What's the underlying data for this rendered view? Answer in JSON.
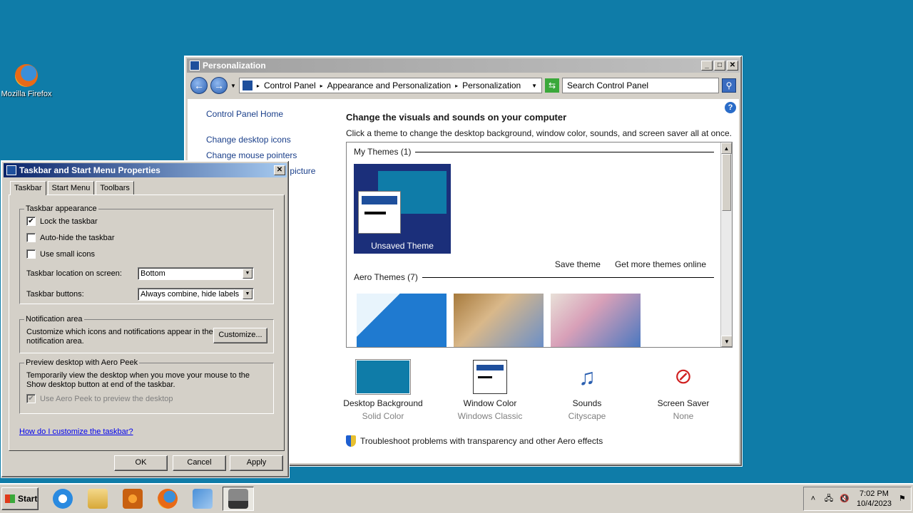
{
  "desktop": {
    "icons": [
      {
        "label": "Mozilla Firefox",
        "icon": "firefox-icon"
      }
    ]
  },
  "personalization": {
    "title": "Personalization",
    "breadcrumb": [
      "Control Panel",
      "Appearance and Personalization",
      "Personalization"
    ],
    "search_placeholder": "Search Control Panel",
    "left_nav": {
      "home": "Control Panel Home",
      "links": [
        "Change desktop icons",
        "Change mouse pointers",
        "Change your account picture"
      ]
    },
    "heading": "Change the visuals and sounds on your computer",
    "subheading": "Click a theme to change the desktop background, window color, sounds, and screen saver all at once.",
    "my_themes_header": "My Themes (1)",
    "my_theme_name": "Unsaved Theme",
    "save_theme": "Save theme",
    "get_more_themes": "Get more themes online",
    "aero_themes_header": "Aero Themes (7)",
    "bottom": [
      {
        "label": "Desktop Background",
        "sub": "Solid Color",
        "icon": "desktop-background-icon"
      },
      {
        "label": "Window Color",
        "sub": "Windows Classic",
        "icon": "window-color-icon"
      },
      {
        "label": "Sounds",
        "sub": "Cityscape",
        "icon": "sounds-icon"
      },
      {
        "label": "Screen Saver",
        "sub": "None",
        "icon": "screen-saver-icon"
      }
    ],
    "troubleshoot": "Troubleshoot problems with transparency and other Aero effects"
  },
  "taskbar_props": {
    "title": "Taskbar and Start Menu Properties",
    "tabs": [
      "Taskbar",
      "Start Menu",
      "Toolbars"
    ],
    "appearance_legend": "Taskbar appearance",
    "lock_label": "Lock the taskbar",
    "lock_checked": true,
    "autohide_label": "Auto-hide the taskbar",
    "autohide_checked": false,
    "small_icons_label": "Use small icons",
    "small_icons_checked": false,
    "location_label": "Taskbar location on screen:",
    "location_value": "Bottom",
    "buttons_label": "Taskbar buttons:",
    "buttons_value": "Always combine, hide labels",
    "notif_legend": "Notification area",
    "notif_text": "Customize which icons and notifications appear in the notification area.",
    "customize_button": "Customize...",
    "peek_legend": "Preview desktop with Aero Peek",
    "peek_text": "Temporarily view the desktop when you move your mouse to the Show desktop button at end of the taskbar.",
    "peek_checkbox_label": "Use Aero Peek to preview the desktop",
    "peek_checked": true,
    "help_link": "How do I customize the taskbar?",
    "ok": "OK",
    "cancel": "Cancel",
    "apply": "Apply"
  },
  "taskbar": {
    "start": "Start",
    "apps": [
      "internet-explorer-icon",
      "file-explorer-icon",
      "media-player-icon",
      "firefox-icon",
      "control-panel-icon",
      "taskbar-properties-icon"
    ],
    "time": "7:02 PM",
    "date": "10/4/2023"
  }
}
